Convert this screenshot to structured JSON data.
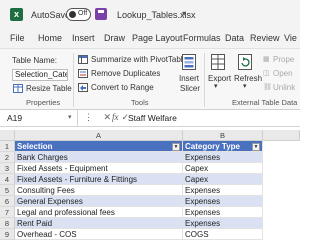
{
  "titlebar": {
    "autosave_label": "AutoSave",
    "autosave_state": "Off",
    "filename": "Lookup_Tables.xlsx",
    "filename_caret": "▾"
  },
  "menu_tabs": [
    "File",
    "Home",
    "Insert",
    "Draw",
    "Page Layout",
    "Formulas",
    "Data",
    "Review",
    "Vie"
  ],
  "ribbon": {
    "properties": {
      "table_name_label": "Table Name:",
      "table_name_value": "Selection_Catego",
      "resize_table_label": "Resize Table",
      "group_label": "Properties"
    },
    "tools": {
      "summarize_label": "Summarize with PivotTable",
      "remove_duplicates_label": "Remove Duplicates",
      "convert_to_range_label": "Convert to Range",
      "group_label": "Tools"
    },
    "insert_slicer": {
      "line1": "Insert",
      "line2": "Slicer"
    },
    "external": {
      "export_label": "Export",
      "refresh_label": "Refresh",
      "properties_label": "Prope",
      "open_label": "Open",
      "unlink_label": "Unlink",
      "group_label": "External Table Data"
    }
  },
  "formula_bar": {
    "cell_ref": "A19",
    "icons": "⋮ ✕ ✓",
    "fx_label": "fx",
    "value": "Staff Welfare"
  },
  "grid": {
    "col_a": "A",
    "col_b": "B",
    "rows": [
      {
        "num": "1",
        "a": "Selection",
        "b": "Category Type"
      },
      {
        "num": "2",
        "a": "Bank Charges",
        "b": "Expenses"
      },
      {
        "num": "3",
        "a": "Fixed Assets - Equipment",
        "b": "Capex"
      },
      {
        "num": "4",
        "a": "Fixed Assets - Furniture & Fittings",
        "b": "Capex"
      },
      {
        "num": "5",
        "a": "Consulting Fees",
        "b": "Expenses"
      },
      {
        "num": "6",
        "a": "General Expenses",
        "b": "Expenses"
      },
      {
        "num": "7",
        "a": "Legal and professional fees",
        "b": "Expenses"
      },
      {
        "num": "8",
        "a": "Rent Paid",
        "b": "Expenses"
      },
      {
        "num": "9",
        "a": "Overhead - COS",
        "b": "COGS"
      }
    ]
  },
  "colors": {
    "table_header": "#4a70c0",
    "band_row": "#d9e1f2",
    "excel_green": "#1d6f42"
  }
}
